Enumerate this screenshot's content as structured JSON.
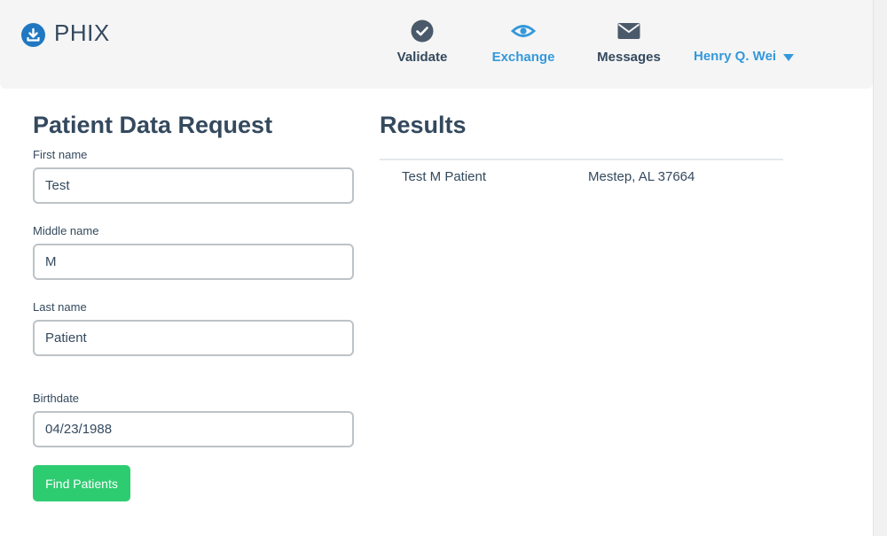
{
  "brand": {
    "name": "PHIX",
    "icon": "download-icon",
    "color": "#1f78c1"
  },
  "nav": {
    "validate": {
      "label": "Validate",
      "icon": "check-circle-icon"
    },
    "exchange": {
      "label": "Exchange",
      "icon": "eye-icon",
      "active": true
    },
    "messages": {
      "label": "Messages",
      "icon": "envelope-icon"
    },
    "user": {
      "name": "Henry Q. Wei",
      "icon": "caret-down-icon"
    }
  },
  "form": {
    "title": "Patient Data Request",
    "first_name": {
      "label": "First name",
      "value": "Test"
    },
    "middle_name": {
      "label": "Middle name",
      "value": "M"
    },
    "last_name": {
      "label": "Last name",
      "value": "Patient"
    },
    "birthdate": {
      "label": "Birthdate",
      "value": "04/23/1988"
    },
    "submit_label": "Find Patients"
  },
  "results": {
    "title": "Results",
    "rows": [
      {
        "name": "Test M Patient",
        "address": "Mestep, AL 37664"
      }
    ]
  },
  "colors": {
    "accent": "#3498db",
    "text": "#34495e",
    "success": "#2ecc71",
    "navbar_bg": "#f5f5f5"
  }
}
